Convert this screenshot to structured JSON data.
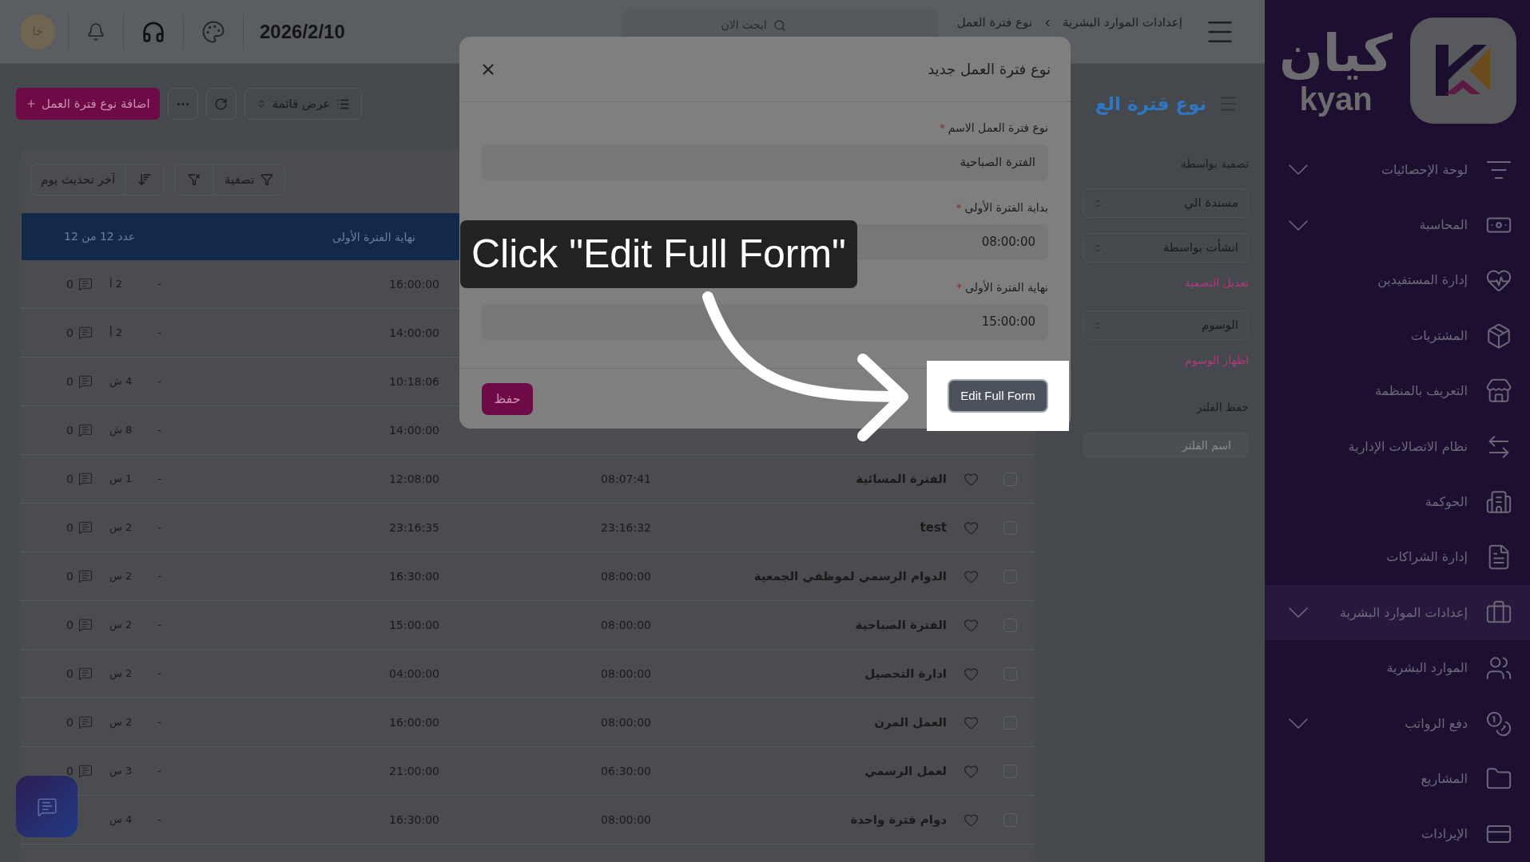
{
  "top_bar": {
    "avatar": "خا",
    "date": "2026/2/10",
    "search": {
      "placeholder": "ابحث الان"
    },
    "breadcrumb": [
      {
        "label": "إعدادات الموارد البشرية"
      },
      {
        "label": "نوع فترة العمل"
      }
    ]
  },
  "page": {
    "title": "نوع فترة الع",
    "add_button": "اضافة نوع فترة العمل",
    "view_select": "عرض قائمة"
  },
  "filters": {
    "heading": "تصفية بواسطة",
    "controls": [
      {
        "kind": "select",
        "label": "مسندة الي"
      },
      {
        "kind": "select",
        "label": "انشأت بواسطة"
      },
      {
        "kind": "link",
        "label": "تعديل التصفية"
      },
      {
        "kind": "select",
        "label": "الوسوم"
      },
      {
        "kind": "link",
        "label": "اظهار الوسوم"
      },
      {
        "kind": "heading",
        "label": "حفظ الفلتر"
      },
      {
        "kind": "input",
        "placeholder": "اسم الفلتر"
      }
    ]
  },
  "table": {
    "filter_button": "تصفية",
    "sort_button": "آخر تحديث يوم",
    "header": {
      "end_label": "نهاية الفترة الأولى",
      "count_label": "عدد 12 من 12"
    },
    "rows": [
      {
        "end": "16:00:00",
        "dash": "-",
        "age": "2 أ",
        "comments": "0"
      },
      {
        "end": "14:00:00",
        "dash": "-",
        "age": "2 أ",
        "comments": "0"
      },
      {
        "end": "10:18:06",
        "dash": "-",
        "age": "4 ش",
        "comments": "0"
      },
      {
        "end": "14:00:00",
        "dash": "-",
        "age": "8 ش",
        "comments": "0"
      },
      {
        "name": "الفترة المسائية",
        "start": "08:07:41",
        "end": "12:08:00",
        "dash": "-",
        "age": "1 س",
        "comments": "0",
        "checked": false,
        "favorite": false
      },
      {
        "name": "test",
        "start": "23:16:32",
        "end": "23:16:35",
        "dash": "-",
        "age": "2 س",
        "comments": "0",
        "checked": false,
        "favorite": false
      },
      {
        "name": "الدوام الرسمي لموظفي الجمعية",
        "start": "08:00:00",
        "end": "16:30:00",
        "dash": "-",
        "age": "2 س",
        "comments": "0",
        "checked": false,
        "favorite": false
      },
      {
        "name": "الفترة الصباحية",
        "start": "08:00:00",
        "end": "15:00:00",
        "dash": "-",
        "age": "2 س",
        "comments": "0",
        "checked": false,
        "favorite": false
      },
      {
        "name": "ادارة التحصيل",
        "start": "08:00:00",
        "end": "04:00:00",
        "dash": "-",
        "age": "2 س",
        "comments": "0",
        "checked": false,
        "favorite": false
      },
      {
        "name": "العمل المرن",
        "start": "08:00:00",
        "end": "16:00:00",
        "dash": "-",
        "age": "2 س",
        "comments": "0",
        "checked": false,
        "favorite": false
      },
      {
        "name": "لعمل الرسمي",
        "start": "06:30:00",
        "end": "21:00:00",
        "dash": "-",
        "age": "3 س",
        "comments": "0",
        "checked": false,
        "favorite": false
      },
      {
        "name": "دوام فترة واحدة",
        "start": "08:00:00",
        "end": "16:30:00",
        "dash": "-",
        "age": "4 س",
        "checked": false,
        "favorite": false
      }
    ]
  },
  "modal": {
    "title": "نوع فترة العمل جديد",
    "fields": [
      {
        "label": "نوع فترة العمل الاسم",
        "required": true,
        "value": "الفترة الصباحية"
      },
      {
        "label": "بداية الفترة الأولى",
        "required": true,
        "value": "08:00:00"
      },
      {
        "label": "نهاية الفترة الأولى",
        "required": true,
        "value": "15:00:00"
      }
    ],
    "required_mark": "*",
    "save_button": "حفظ",
    "edit_button": "Edit Full Form"
  },
  "tooltip": {
    "text": "Click \"Edit Full Form\""
  },
  "sidebar": {
    "logo_text": "كيان",
    "logo_latin": "kyan",
    "items": [
      {
        "label": "لوحة الإحصائيات",
        "expandable": true,
        "selected": false
      },
      {
        "label": "المحاسبة",
        "expandable": true,
        "selected": false
      },
      {
        "label": "إدارة المستفيدين",
        "expandable": false,
        "selected": false
      },
      {
        "label": "المشتريات",
        "expandable": false,
        "selected": false
      },
      {
        "label": "التعريف بالمنظمة",
        "expandable": false,
        "selected": false
      },
      {
        "label": "نظام الاتصالات الإدارية",
        "expandable": false,
        "selected": false
      },
      {
        "label": "الحوكمة",
        "expandable": false,
        "selected": false
      },
      {
        "label": "إدارة الشراكات",
        "expandable": false,
        "selected": false
      },
      {
        "label": "إعدادات الموارد البشرية",
        "expandable": true,
        "selected": true
      },
      {
        "label": "الموارد البشرية",
        "expandable": false,
        "selected": false
      },
      {
        "label": "دفع الرواتب",
        "expandable": true,
        "selected": false
      },
      {
        "label": "المشاريع",
        "expandable": false,
        "selected": false
      },
      {
        "label": "الإيرادات",
        "expandable": false,
        "selected": false
      }
    ]
  }
}
